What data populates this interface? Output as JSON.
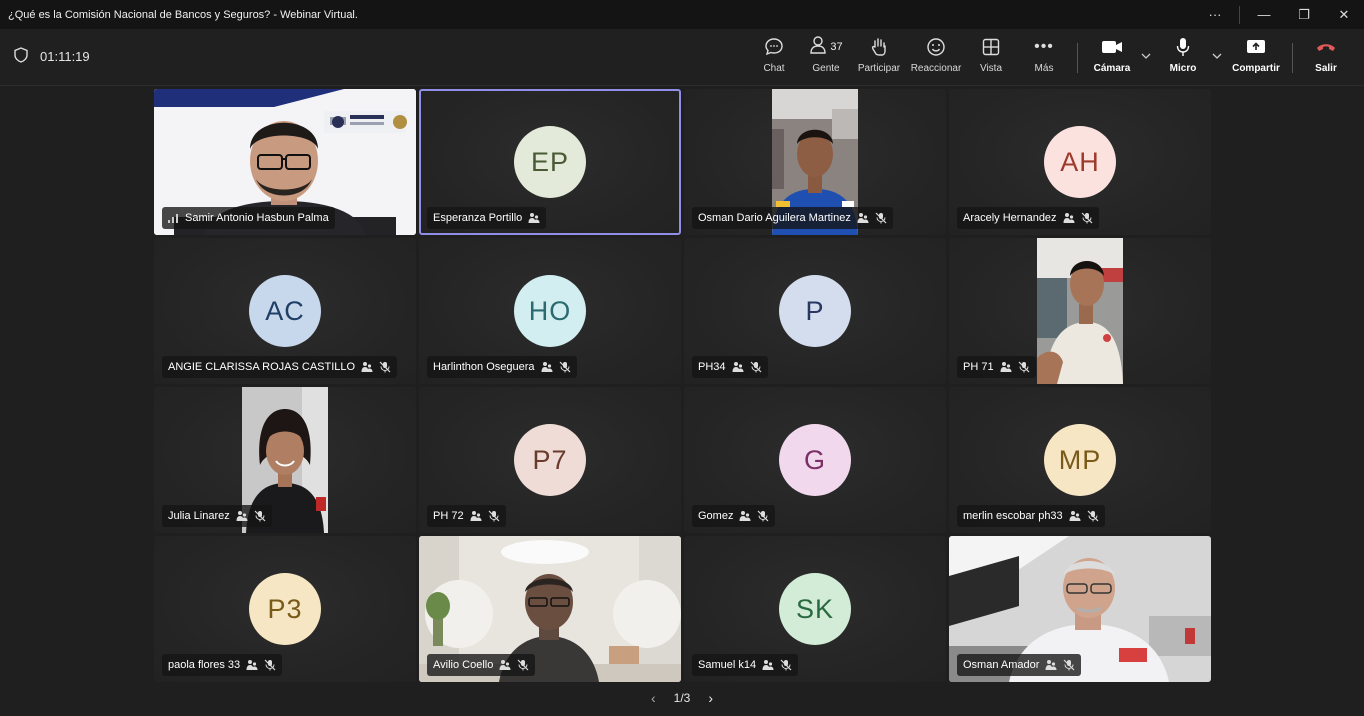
{
  "window": {
    "title": "¿Qué es la Comisión Nacional de Bancos y Seguros? - Webinar Virtual.",
    "more_glyph": "···",
    "minimize_glyph": "—",
    "restore_glyph": "❐",
    "close_glyph": "✕"
  },
  "meeting": {
    "timer": "01:11:19"
  },
  "toolbar": {
    "chat": "Chat",
    "people": "Gente",
    "people_count": "37",
    "raise": "Participar",
    "react": "Reaccionar",
    "view": "Vista",
    "more": "Más",
    "camera": "Cámara",
    "mic": "Micro",
    "share": "Compartir",
    "leave": "Salir"
  },
  "participants": [
    {
      "name": "Samir Antonio Hasbun Palma",
      "type": "video-presenter",
      "icon": "signal-bars-icon"
    },
    {
      "name": "Esperanza Portillo",
      "initials": "EP",
      "bg": "#e3ead9",
      "fg": "#4a5a34",
      "active": true,
      "icons": [
        "raised-hand-icon"
      ]
    },
    {
      "name": "Osman Dario Aguilera Martinez",
      "type": "video-portrait",
      "icons": [
        "raised-hand-icon",
        "mic-off-icon"
      ]
    },
    {
      "name": "Aracely Hernandez",
      "initials": "AH",
      "bg": "#fbe2de",
      "fg": "#9c3a2c",
      "icons": [
        "raised-hand-icon",
        "mic-off-icon"
      ]
    },
    {
      "name": "ANGIE CLARISSA ROJAS CASTILLO",
      "initials": "AC",
      "bg": "#c8d8ec",
      "fg": "#1f3f66",
      "icons": [
        "raised-hand-icon",
        "mic-off-icon"
      ]
    },
    {
      "name": "Harlinthon Oseguera",
      "initials": "HO",
      "bg": "#d2eef0",
      "fg": "#2b6b70",
      "icons": [
        "raised-hand-icon",
        "mic-off-icon"
      ]
    },
    {
      "name": "PH34",
      "initials": "P",
      "bg": "#d4ddee",
      "fg": "#27375e",
      "icons": [
        "raised-hand-icon",
        "mic-off-icon"
      ]
    },
    {
      "name": "PH 71",
      "type": "video-portrait2",
      "icons": [
        "raised-hand-icon",
        "mic-off-icon"
      ]
    },
    {
      "name": "Julia Linarez",
      "type": "video-portrait3",
      "icons": [
        "raised-hand-icon",
        "mic-off-icon"
      ]
    },
    {
      "name": "PH 72",
      "initials": "P7",
      "bg": "#efdcd6",
      "fg": "#6a3a2c",
      "icons": [
        "raised-hand-icon",
        "mic-off-icon"
      ]
    },
    {
      "name": "Gomez",
      "initials": "G",
      "bg": "#f2d8ec",
      "fg": "#7a2f66",
      "icons": [
        "raised-hand-icon",
        "mic-off-icon"
      ]
    },
    {
      "name": "merlin escobar ph33",
      "initials": "MP",
      "bg": "#f6e6c4",
      "fg": "#7a5a18",
      "icons": [
        "raised-hand-icon",
        "mic-off-icon"
      ]
    },
    {
      "name": "paola flores 33",
      "initials": "P3",
      "bg": "#f6e6c4",
      "fg": "#7a5a18",
      "icons": [
        "raised-hand-icon",
        "mic-off-icon"
      ]
    },
    {
      "name": "Avilio Coello",
      "type": "video-room",
      "icons": [
        "raised-hand-icon",
        "mic-off-icon"
      ]
    },
    {
      "name": "Samuel k14",
      "initials": "SK",
      "bg": "#d2ecd8",
      "fg": "#2a6a40",
      "icons": [
        "raised-hand-icon",
        "mic-off-icon"
      ]
    },
    {
      "name": "Osman Amador",
      "type": "video-office",
      "icons": [
        "raised-hand-icon",
        "mic-off-icon"
      ]
    }
  ],
  "pager": {
    "label": "1/3"
  },
  "colors": {
    "accent": "#8f8fe8",
    "leave": "#e05a5a",
    "bg": "#1f1f1f"
  }
}
